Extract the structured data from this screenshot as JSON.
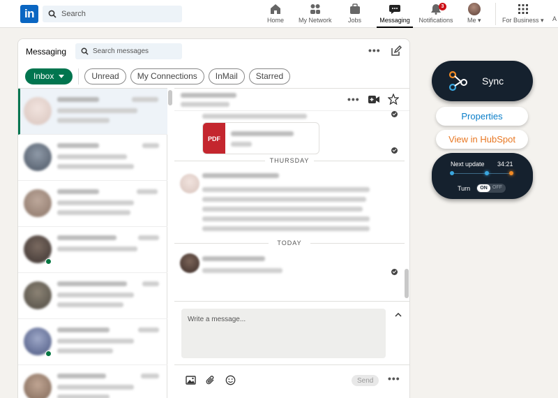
{
  "topnav": {
    "logo": "in",
    "search_placeholder": "Search",
    "items": [
      {
        "label": "Home",
        "icon": "home-icon"
      },
      {
        "label": "My Network",
        "icon": "network-icon"
      },
      {
        "label": "Jobs",
        "icon": "briefcase-icon"
      },
      {
        "label": "Messaging",
        "icon": "messaging-icon",
        "active": true
      },
      {
        "label": "Notifications",
        "icon": "bell-icon",
        "badge": "3"
      },
      {
        "label": "Me",
        "icon": "avatar"
      },
      {
        "label": "For Business",
        "icon": "grid-icon"
      },
      {
        "label": "A",
        "icon": ""
      }
    ]
  },
  "messaging": {
    "title": "Messaging",
    "search_placeholder": "Search messages",
    "filters": [
      "Inbox",
      "Unread",
      "My Connections",
      "InMail",
      "Starred"
    ]
  },
  "thread": {
    "attachment_type": "PDF",
    "dividers": [
      "THURSDAY",
      "TODAY"
    ],
    "composer_placeholder": "Write a message...",
    "send_label": "Send"
  },
  "widget": {
    "sync_label": "Sync",
    "properties_label": "Properties",
    "hubspot_label": "View in HubSpot",
    "next_update_label": "Next update",
    "next_update_time": "34:21",
    "turn_label": "Turn",
    "toggle_on": "ON",
    "toggle_off": "OFF"
  },
  "colors": {
    "linkedin_blue": "#0a66c2",
    "inbox_green": "#01754f",
    "widget_dark": "#15212e",
    "hubspot_orange": "#e87722",
    "properties_blue": "#0a7ec9"
  }
}
